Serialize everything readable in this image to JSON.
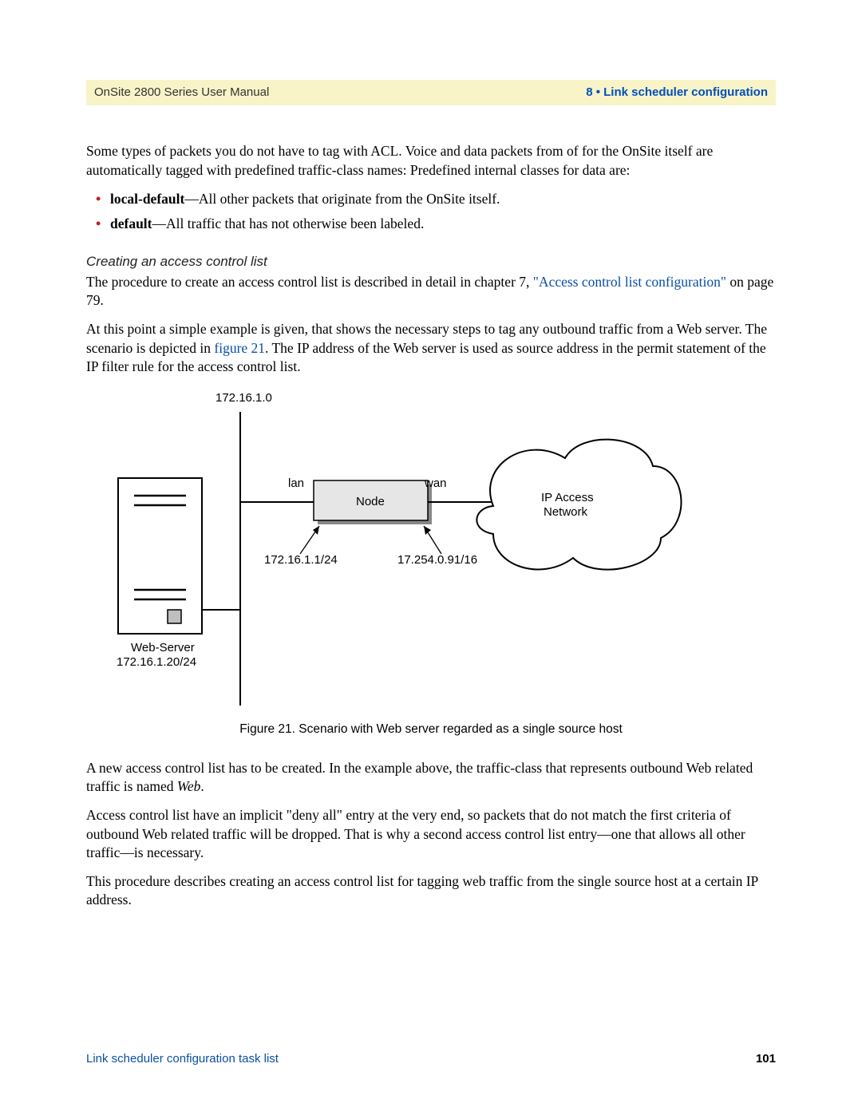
{
  "header": {
    "left": "OnSite 2800 Series User Manual",
    "right": "8 • Link scheduler configuration"
  },
  "intro_para": "Some types of packets you do not have to tag with ACL. Voice and data packets from of for the OnSite itself are automatically tagged with predefined traffic-class names: Predefined internal classes for data are:",
  "bullets": [
    {
      "term": "local-default",
      "desc": "—All other packets that originate from the OnSite itself."
    },
    {
      "term": "default",
      "desc": "—All traffic that has not otherwise been labeled."
    }
  ],
  "subhead": "Creating an access control list",
  "para_acl_1_pre": "The procedure to create an access control list is described in detail in chapter 7, ",
  "para_acl_1_link": "\"Access control list configuration\"",
  "para_acl_1_post": " on page 79.",
  "para_acl_2_pre": "At this point a simple example is given, that shows the necessary steps to tag any outbound traffic from a Web server. The scenario is depicted in ",
  "para_acl_2_link": "figure 21",
  "para_acl_2_post": ". The IP address of the Web server is used as source address in the permit statement of the IP filter rule for the access control list.",
  "diagram": {
    "top_network": "172.16.1.0",
    "lan_label": "lan",
    "wan_label": "wan",
    "node_label": "Node",
    "cloud_line1": "IP Access",
    "cloud_line2": "Network",
    "lan_addr": "172.16.1.1/24",
    "wan_addr": "17.254.0.91/16",
    "server_label": "Web-Server",
    "server_addr": "172.16.1.20/24"
  },
  "caption": "Figure 21. Scenario with Web server regarded as a single source host",
  "para_after_1_pre": "A new access control list has to be created. In the example above, the traffic-class that represents outbound Web related traffic is named ",
  "para_after_1_em": "Web",
  "para_after_1_post": ".",
  "para_after_2": "Access control list have an implicit \"deny all\" entry at the very end, so packets that do not match the first criteria of outbound Web related traffic will be dropped. That is why a second access control list entry—one that allows all other traffic—is necessary.",
  "para_after_3": "This procedure describes creating an access control list for tagging web traffic from the single source host at a certain IP address.",
  "footer": {
    "left": "Link scheduler configuration task list",
    "right": "101"
  }
}
